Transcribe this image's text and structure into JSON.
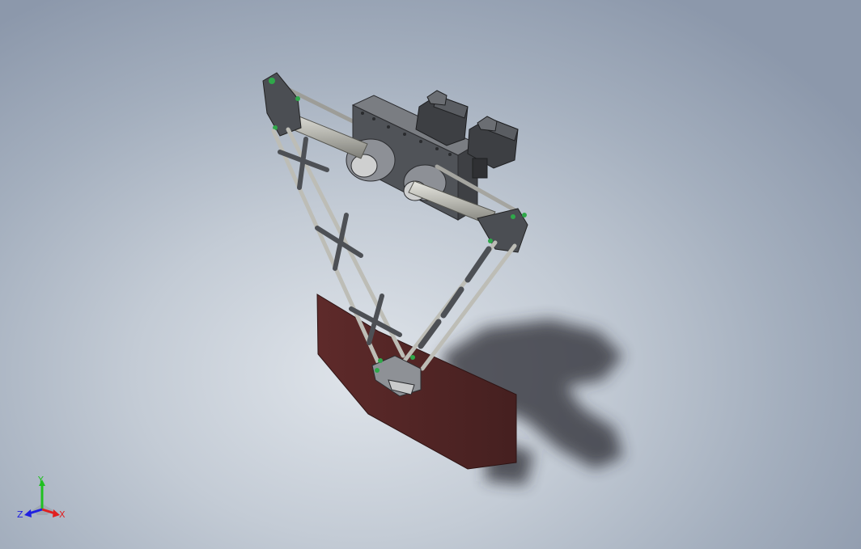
{
  "triad": {
    "x_label": "X",
    "y_label": "Y",
    "z_label": "Z",
    "x_color": "#e02020",
    "y_color": "#20c020",
    "z_color": "#2020e0"
  },
  "colors": {
    "background_center": "#dfe4ea",
    "background_edge": "#8c98ab",
    "housing": "#5e6166",
    "shaft": "#b8b8b2",
    "joint_accent": "#2fa84a",
    "base_plate": "#4e2424"
  }
}
